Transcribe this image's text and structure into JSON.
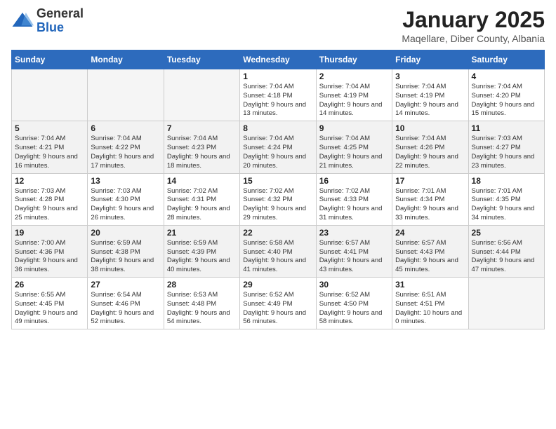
{
  "logo": {
    "general": "General",
    "blue": "Blue"
  },
  "header": {
    "month": "January 2025",
    "location": "Maqellare, Diber County, Albania"
  },
  "weekdays": [
    "Sunday",
    "Monday",
    "Tuesday",
    "Wednesday",
    "Thursday",
    "Friday",
    "Saturday"
  ],
  "weeks": [
    [
      null,
      null,
      null,
      {
        "day": 1,
        "sunrise": "7:04 AM",
        "sunset": "4:18 PM",
        "daylight": "9 hours and 13 minutes."
      },
      {
        "day": 2,
        "sunrise": "7:04 AM",
        "sunset": "4:19 PM",
        "daylight": "9 hours and 14 minutes."
      },
      {
        "day": 3,
        "sunrise": "7:04 AM",
        "sunset": "4:19 PM",
        "daylight": "9 hours and 14 minutes."
      },
      {
        "day": 4,
        "sunrise": "7:04 AM",
        "sunset": "4:20 PM",
        "daylight": "9 hours and 15 minutes."
      }
    ],
    [
      {
        "day": 5,
        "sunrise": "7:04 AM",
        "sunset": "4:21 PM",
        "daylight": "9 hours and 16 minutes."
      },
      {
        "day": 6,
        "sunrise": "7:04 AM",
        "sunset": "4:22 PM",
        "daylight": "9 hours and 17 minutes."
      },
      {
        "day": 7,
        "sunrise": "7:04 AM",
        "sunset": "4:23 PM",
        "daylight": "9 hours and 18 minutes."
      },
      {
        "day": 8,
        "sunrise": "7:04 AM",
        "sunset": "4:24 PM",
        "daylight": "9 hours and 20 minutes."
      },
      {
        "day": 9,
        "sunrise": "7:04 AM",
        "sunset": "4:25 PM",
        "daylight": "9 hours and 21 minutes."
      },
      {
        "day": 10,
        "sunrise": "7:04 AM",
        "sunset": "4:26 PM",
        "daylight": "9 hours and 22 minutes."
      },
      {
        "day": 11,
        "sunrise": "7:03 AM",
        "sunset": "4:27 PM",
        "daylight": "9 hours and 23 minutes."
      }
    ],
    [
      {
        "day": 12,
        "sunrise": "7:03 AM",
        "sunset": "4:28 PM",
        "daylight": "9 hours and 25 minutes."
      },
      {
        "day": 13,
        "sunrise": "7:03 AM",
        "sunset": "4:30 PM",
        "daylight": "9 hours and 26 minutes."
      },
      {
        "day": 14,
        "sunrise": "7:02 AM",
        "sunset": "4:31 PM",
        "daylight": "9 hours and 28 minutes."
      },
      {
        "day": 15,
        "sunrise": "7:02 AM",
        "sunset": "4:32 PM",
        "daylight": "9 hours and 29 minutes."
      },
      {
        "day": 16,
        "sunrise": "7:02 AM",
        "sunset": "4:33 PM",
        "daylight": "9 hours and 31 minutes."
      },
      {
        "day": 17,
        "sunrise": "7:01 AM",
        "sunset": "4:34 PM",
        "daylight": "9 hours and 33 minutes."
      },
      {
        "day": 18,
        "sunrise": "7:01 AM",
        "sunset": "4:35 PM",
        "daylight": "9 hours and 34 minutes."
      }
    ],
    [
      {
        "day": 19,
        "sunrise": "7:00 AM",
        "sunset": "4:36 PM",
        "daylight": "9 hours and 36 minutes."
      },
      {
        "day": 20,
        "sunrise": "6:59 AM",
        "sunset": "4:38 PM",
        "daylight": "9 hours and 38 minutes."
      },
      {
        "day": 21,
        "sunrise": "6:59 AM",
        "sunset": "4:39 PM",
        "daylight": "9 hours and 40 minutes."
      },
      {
        "day": 22,
        "sunrise": "6:58 AM",
        "sunset": "4:40 PM",
        "daylight": "9 hours and 41 minutes."
      },
      {
        "day": 23,
        "sunrise": "6:57 AM",
        "sunset": "4:41 PM",
        "daylight": "9 hours and 43 minutes."
      },
      {
        "day": 24,
        "sunrise": "6:57 AM",
        "sunset": "4:43 PM",
        "daylight": "9 hours and 45 minutes."
      },
      {
        "day": 25,
        "sunrise": "6:56 AM",
        "sunset": "4:44 PM",
        "daylight": "9 hours and 47 minutes."
      }
    ],
    [
      {
        "day": 26,
        "sunrise": "6:55 AM",
        "sunset": "4:45 PM",
        "daylight": "9 hours and 49 minutes."
      },
      {
        "day": 27,
        "sunrise": "6:54 AM",
        "sunset": "4:46 PM",
        "daylight": "9 hours and 52 minutes."
      },
      {
        "day": 28,
        "sunrise": "6:53 AM",
        "sunset": "4:48 PM",
        "daylight": "9 hours and 54 minutes."
      },
      {
        "day": 29,
        "sunrise": "6:52 AM",
        "sunset": "4:49 PM",
        "daylight": "9 hours and 56 minutes."
      },
      {
        "day": 30,
        "sunrise": "6:52 AM",
        "sunset": "4:50 PM",
        "daylight": "9 hours and 58 minutes."
      },
      {
        "day": 31,
        "sunrise": "6:51 AM",
        "sunset": "4:51 PM",
        "daylight": "10 hours and 0 minutes."
      },
      null
    ]
  ]
}
